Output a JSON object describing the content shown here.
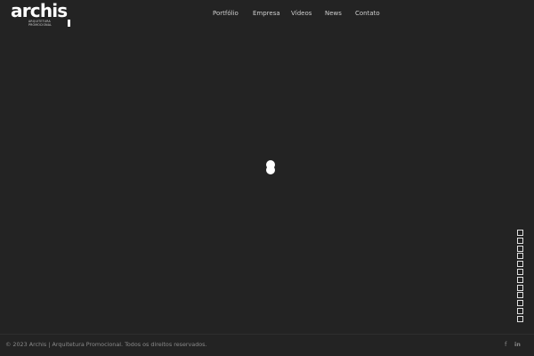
{
  "brand": {
    "name": "archis",
    "tagline_line1": "ARQUITETURA",
    "tagline_line2": "PROMOCIONAL"
  },
  "nav": {
    "items": [
      {
        "label": "Portfólio"
      },
      {
        "label": "Empresa"
      },
      {
        "label": "Vídeos"
      },
      {
        "label": "News"
      },
      {
        "label": "Contato"
      }
    ]
  },
  "loader": {
    "icon": "loading-spinner-icon"
  },
  "slider": {
    "count": 12,
    "icon": "slide-square-icon"
  },
  "footer": {
    "copyright": "© 2023 Archis | Arquitetura Promocional. Todos os direitos reservados.",
    "social": {
      "facebook_glyph": "f",
      "linkedin_glyph": "in"
    }
  },
  "colors": {
    "background": "#232323",
    "text": "#ffffff",
    "muted": "#8a8a8a"
  }
}
